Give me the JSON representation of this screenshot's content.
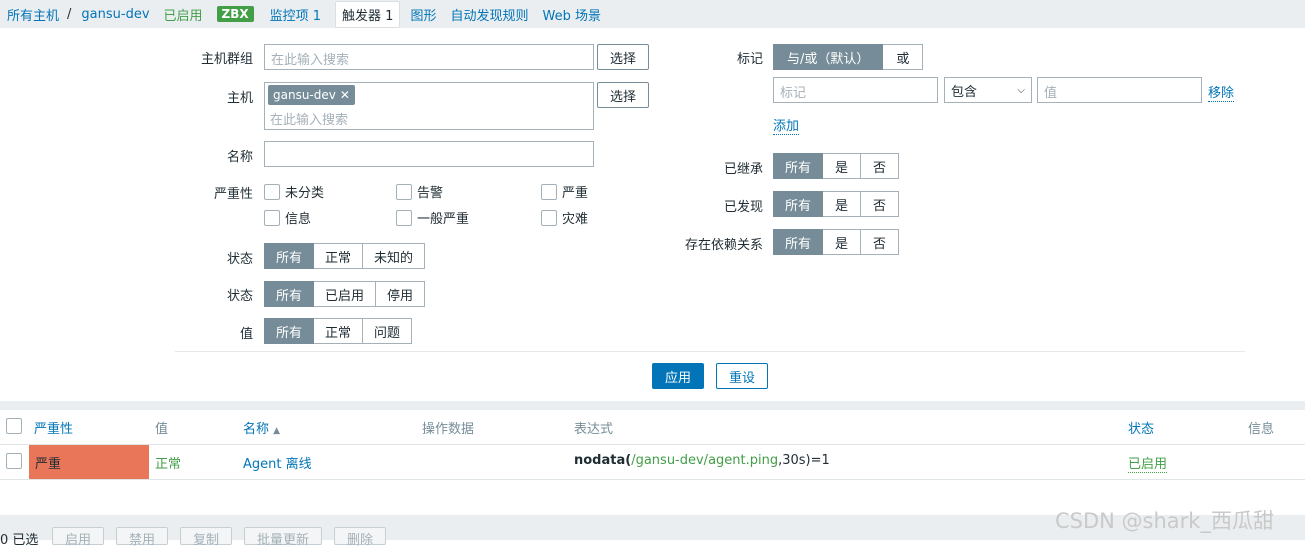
{
  "breadcrumb": {
    "all_hosts": "所有主机",
    "separator": "/",
    "host": "gansu-dev",
    "enabled": "已启用",
    "zbx": "ZBX",
    "items": "监控项 1",
    "triggers": "触发器 1",
    "graphs": "图形",
    "discovery": "自动发现规则",
    "web": "Web 场景"
  },
  "filter": {
    "host_group_label": "主机群组",
    "host_group_placeholder": "在此输入搜索",
    "select_label": "选择",
    "host_label": "主机",
    "host_chip": "gansu-dev",
    "host_placeholder": "在此输入搜索",
    "name_label": "名称",
    "severity_label": "严重性",
    "severities": [
      "未分类",
      "告警",
      "严重",
      "信息",
      "一般严重",
      "灾难"
    ],
    "state_label": "状态",
    "state_options": [
      "所有",
      "正常",
      "未知的"
    ],
    "status_label": "状态",
    "status_options": [
      "所有",
      "已启用",
      "停用"
    ],
    "value_label": "值",
    "value_options": [
      "所有",
      "正常",
      "问题"
    ],
    "tags_label": "标记",
    "tags_mode": [
      "与/或（默认）",
      "或"
    ],
    "tag_placeholder": "标记",
    "tag_operator": "包含",
    "value_placeholder": "值",
    "remove": "移除",
    "add": "添加",
    "inherited_label": "已继承",
    "discovered_label": "已发现",
    "dependency_label": "存在依赖关系",
    "tri_options": [
      "所有",
      "是",
      "否"
    ],
    "apply": "应用",
    "reset": "重设"
  },
  "table": {
    "headers": {
      "severity": "严重性",
      "value": "值",
      "name": "名称",
      "sort_arrow": "▲",
      "operational_data": "操作数据",
      "expression": "表达式",
      "status": "状态",
      "info": "信息"
    },
    "rows": [
      {
        "severity": "严重",
        "severity_color": "#e97659",
        "value": "正常",
        "name": "Agent 离线",
        "expr_func": "nodata(",
        "expr_item": "/gansu-dev/agent.ping",
        "expr_rest": ",30s)=1",
        "status": "已启用"
      }
    ]
  },
  "footer": {
    "selected": "0 已选",
    "buttons": [
      "启用",
      "禁用",
      "复制",
      "批量更新",
      "删除"
    ]
  },
  "watermark": "CSDN @shark_西瓜甜"
}
